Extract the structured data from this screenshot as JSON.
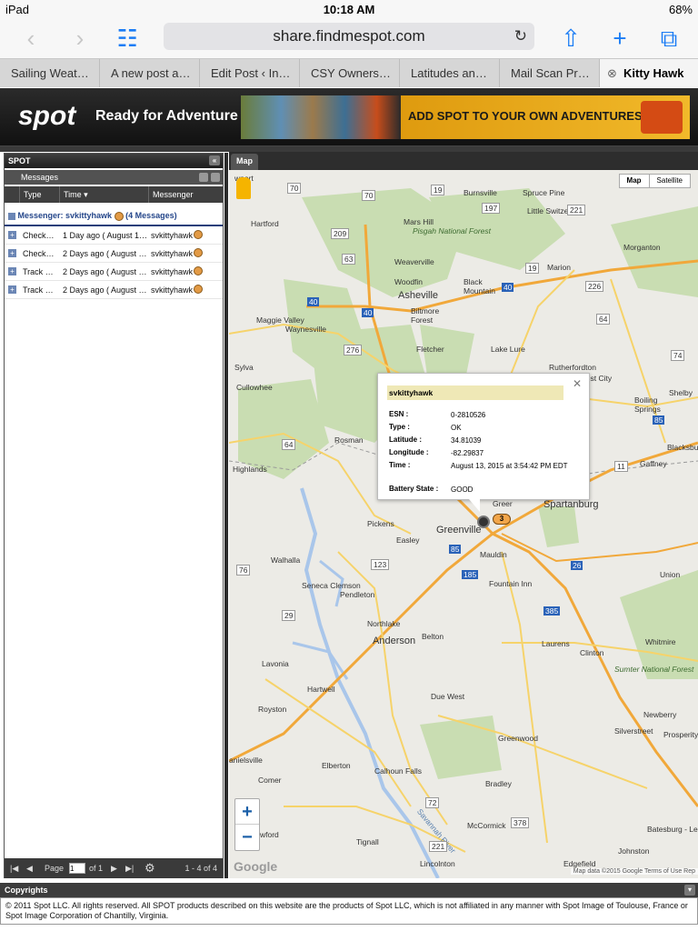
{
  "status": {
    "device": "iPad",
    "time": "10:18 AM",
    "battery": "68%"
  },
  "browser": {
    "url": "share.findmespot.com"
  },
  "tabs": [
    "Sailing Weat…",
    "A new post a…",
    "Edit Post ‹ In…",
    "CSY Owners…",
    "Latitudes an…",
    "Mail Scan Pr…",
    "Kitty Hawk"
  ],
  "banner": {
    "logo": "spot",
    "tagline": "Ready for Adventure",
    "ad_text": "ADD SPOT TO YOUR OWN ADVENTURES>>"
  },
  "panel": {
    "title": "SPOT",
    "messages_label": "Messages",
    "columns": [
      "Type",
      "Time",
      "Messenger"
    ],
    "group_label": "Messenger: svkittyhawk",
    "group_count": "(4 Messages)",
    "rows": [
      {
        "type": "Check…",
        "time": "1 Day ago ( August 1…",
        "messenger": "svkittyhawk"
      },
      {
        "type": "Check…",
        "time": "2 Days ago ( August …",
        "messenger": "svkittyhawk"
      },
      {
        "type": "Track …",
        "time": "2 Days ago ( August …",
        "messenger": "svkittyhawk"
      },
      {
        "type": "Track …",
        "time": "2 Days ago ( August …",
        "messenger": "svkittyhawk"
      }
    ],
    "pager": {
      "page_label": "Page",
      "page_value": "1",
      "of_label": "of 1",
      "range": "1 - 4 of 4"
    }
  },
  "map": {
    "tab": "Map",
    "type_map": "Map",
    "type_satellite": "Satellite",
    "google": "Google",
    "footer": "Map data ©2015 Google   Terms of Use   Rep",
    "labels": {
      "newport": "wport",
      "burnsville": "Burnsville",
      "spruce_pine": "Spruce Pine",
      "hartford": "Hartford",
      "mars_hill": "Mars Hill",
      "little_switzerland": "Little Switzerland",
      "pisgah": "Pisgah National Forest",
      "morganton": "Morganton",
      "marion": "Marion",
      "weaverville": "Weaverville",
      "woodfin": "Woodfin",
      "black_mountain": "Black Mountain",
      "asheville": "Asheville",
      "maggie_valley": "Maggie Valley",
      "waynesville": "Waynesville",
      "biltmore_forest": "Biltmore Forest",
      "fletcher": "Fletcher",
      "lake_lure": "Lake Lure",
      "sylva": "Sylva",
      "rutherfordton": "Rutherfordton",
      "forest_city": "Forest City",
      "cullowhee": "Cullowhee",
      "shelby": "Shelby",
      "boiling_springs": "Boiling Springs",
      "rosman": "Rosman",
      "highlands": "Highlands",
      "blacksburg": "Blacksbu",
      "gaffney": "Gaffney",
      "greer": "Greer",
      "spartanburg": "Spartanburg",
      "pickens": "Pickens",
      "greenville": "Greenville",
      "easley": "Easley",
      "walhalla": "Walhalla",
      "mauldin": "Mauldin",
      "seneca_clemson": "Seneca Clemson",
      "pendleton": "Pendleton",
      "fountain_inn": "Fountain Inn",
      "union": "Union",
      "northlake": "Northlake",
      "anderson": "Anderson",
      "belton": "Belton",
      "laurens": "Laurens",
      "clinton": "Clinton",
      "whitmire": "Whitmire",
      "sumter": "Sumter National Forest",
      "lavonia": "Lavonia",
      "hartwell": "Hartwell",
      "royston": "Royston",
      "due_west": "Due West",
      "newberry": "Newberry",
      "silverstreet": "Silverstreet",
      "prosperity": "Prosperity",
      "greenwood": "Greenwood",
      "elberton": "Elberton",
      "calhoun_falls": "Calhoun Falls",
      "danielsville": "anielsville",
      "comer": "Comer",
      "bradley": "Bradley",
      "mccormick": "McCormick",
      "batesburg": "Batesburg - Le",
      "crawford": "wford",
      "tignall": "Tignall",
      "lincolnton": "Lincolnton",
      "edgefield": "Edgefield",
      "savannah": "Savannah River",
      "riverton": "Johnston"
    },
    "route_labels": {
      "r70a": "70",
      "r70b": "70",
      "r19": "19",
      "r197": "197",
      "r221": "221",
      "r209": "209",
      "r63": "63",
      "r19b": "19",
      "r40a": "40",
      "r40b": "40",
      "r40c": "40",
      "r226": "226",
      "r276": "276",
      "r64a": "64",
      "r64b": "64",
      "r74": "74",
      "r11": "11",
      "r85a": "85",
      "r85b": "85",
      "r123": "123",
      "r76": "76",
      "r185": "185",
      "r385": "385",
      "r26": "26",
      "r29": "29",
      "r72": "72",
      "r378": "378",
      "r221b": "221"
    }
  },
  "popup": {
    "name": "svkittyhawk",
    "fields": [
      {
        "k": "ESN :",
        "v": "0-2810526"
      },
      {
        "k": "Type :",
        "v": "OK"
      },
      {
        "k": "Latitude :",
        "v": "34.81039"
      },
      {
        "k": "Longitude :",
        "v": "-82.29837"
      },
      {
        "k": "Time :",
        "v": "August 13, 2015 at 3:54:42 PM EDT"
      },
      {
        "k": "Battery State :",
        "v": "GOOD"
      }
    ],
    "cluster_count": "3"
  },
  "footer": {
    "title": "Copyrights",
    "text": "© 2011 Spot LLC. All rights reserved. All SPOT products described on this website are the products of Spot LLC, which is not affiliated in any manner with Spot Image of Toulouse, France or Spot Image Corporation of Chantilly, Virginia."
  }
}
